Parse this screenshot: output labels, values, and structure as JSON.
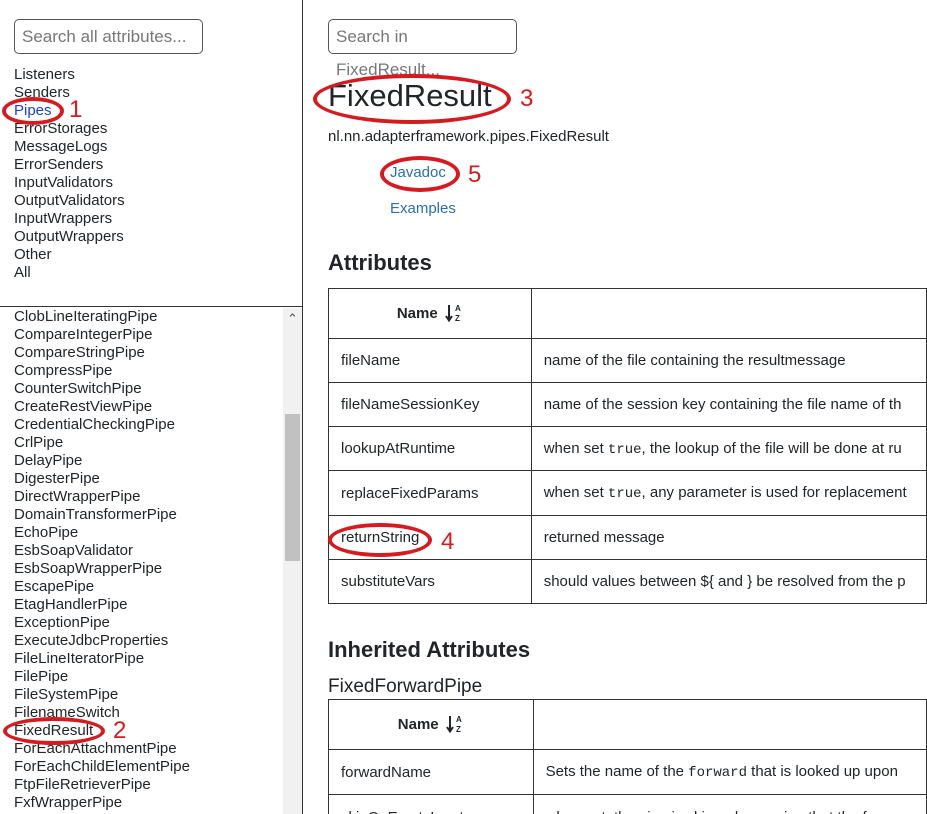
{
  "sidebar": {
    "search_placeholder": "Search all attributes...",
    "categories": [
      "Listeners",
      "Senders",
      "Pipes",
      "ErrorStorages",
      "MessageLogs",
      "ErrorSenders",
      "InputValidators",
      "OutputValidators",
      "InputWrappers",
      "OutputWrappers",
      "Other",
      "All"
    ],
    "active_category": "Pipes",
    "pipes": [
      "ClobLineIteratingPipe",
      "CompareIntegerPipe",
      "CompareStringPipe",
      "CompressPipe",
      "CounterSwitchPipe",
      "CreateRestViewPipe",
      "CredentialCheckingPipe",
      "CrlPipe",
      "DelayPipe",
      "DigesterPipe",
      "DirectWrapperPipe",
      "DomainTransformerPipe",
      "EchoPipe",
      "EsbSoapValidator",
      "EsbSoapWrapperPipe",
      "EscapePipe",
      "EtagHandlerPipe",
      "ExceptionPipe",
      "ExecuteJdbcProperties",
      "FileLineIteratorPipe",
      "FilePipe",
      "FileSystemPipe",
      "FilenameSwitch",
      "FixedResult",
      "ForEachAttachmentPipe",
      "ForEachChildElementPipe",
      "FtpFileRetrieverPipe",
      "FxfWrapperPipe"
    ],
    "scroll_up": "⌃"
  },
  "main": {
    "search_placeholder": "Search in FixedResult...",
    "title": "FixedResult",
    "fqcn": "nl.nn.adapterframework.pipes.FixedResult",
    "javadoc_link": "Javadoc",
    "examples_link": "Examples",
    "attributes_heading": "Attributes",
    "name_header": "Name",
    "attributes": [
      {
        "name": "fileName",
        "desc_pre": "name of the file containing the resultmessage",
        "code": "",
        "desc_post": ""
      },
      {
        "name": "fileNameSessionKey",
        "desc_pre": "name of the session key containing the file name of th",
        "code": "",
        "desc_post": ""
      },
      {
        "name": "lookupAtRuntime",
        "desc_pre": "when set ",
        "code": "true",
        "desc_post": ", the lookup of the file will be done at ru"
      },
      {
        "name": "replaceFixedParams",
        "desc_pre": "when set ",
        "code": "true",
        "desc_post": ", any parameter is used for replacement"
      },
      {
        "name": "returnString",
        "desc_pre": "returned message",
        "code": "",
        "desc_post": ""
      },
      {
        "name": "substituteVars",
        "desc_pre": "should values between ${ and } be resolved from the p",
        "code": "",
        "desc_post": ""
      }
    ],
    "inherited_heading": "Inherited Attributes",
    "inherited_class": "FixedForwardPipe",
    "inherited_attributes": [
      {
        "name": "forwardName",
        "desc_pre": "Sets the name of the ",
        "code": "forward",
        "desc_post": " that is looked up upon "
      },
      {
        "name": "skipOnEmptyInput",
        "desc_pre": "when set, the pipe is skipped, meaning that the f",
        "code": "",
        "desc_post": ""
      }
    ]
  },
  "annotations": [
    "1",
    "2",
    "3",
    "4",
    "5"
  ],
  "colors": {
    "annotation": "#d41b20",
    "link": "#2a6fb0",
    "active_category": "#1a3fd6"
  }
}
